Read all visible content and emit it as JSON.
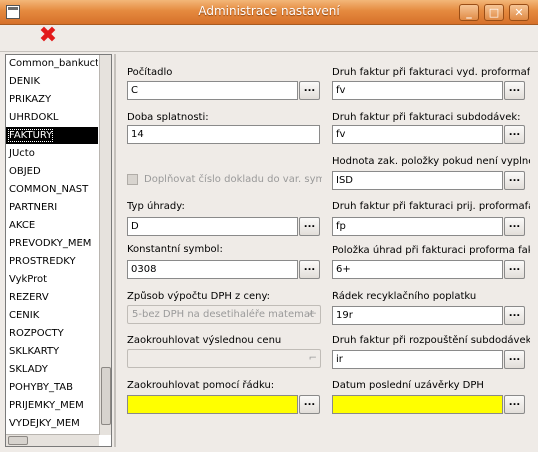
{
  "window": {
    "title": "Administrace nastavení",
    "minimize": "_",
    "maximize": "□",
    "close": "✕"
  },
  "toolbar": {
    "delete_icon": "close-icon-red",
    "delete_glyph": "✖"
  },
  "list": {
    "items": [
      "Common_bankucty",
      "DENIK",
      "PRIKAZY",
      "UHRDOKL",
      "FAKTURY",
      "JUcto",
      "OBJED",
      "COMMON_NAST",
      "PARTNERI",
      "AKCE",
      "PREVODKY_MEM",
      "PROSTREDKY",
      "VykProt",
      "REZERV",
      "CENIK",
      "ROZPOCTY",
      "SKLKARTY",
      "SKLADY",
      "POHYBY_TAB",
      "PRIJEMKY_MEM",
      "VYDEJKY_MEM"
    ],
    "selected": "FAKTURY"
  },
  "left": {
    "pocitadlo": {
      "label": "Počítadlo",
      "value": "C"
    },
    "doba": {
      "label": "Doba splatnosti:",
      "value": "14"
    },
    "doplnovat": {
      "label": "Doplňovat číslo dokladu do var. symb"
    },
    "typ": {
      "label": "Typ úhrady:",
      "value": "D"
    },
    "konst": {
      "label": "Konstantní symbol:",
      "value": "0308"
    },
    "zpusob": {
      "label": "Způsob výpočtu DPH z ceny:",
      "value": "5-bez DPH na desetihaléře matemat"
    },
    "zaokr_cenu": {
      "label": "Zaokrouhlovat výslednou cenu"
    },
    "zaokr_radek": {
      "label": "Zaokrouhlovat pomocí řádku:",
      "value": ""
    }
  },
  "right": {
    "druh_vyd": {
      "label": "Druh faktur při fakturaci vyd. proformafa",
      "value": "fv"
    },
    "druh_sub": {
      "label": "Druh faktur při fakturaci subdodávek:",
      "value": "fv"
    },
    "hodnota": {
      "label": "Hodnota zak. položky pokud není vyplněn",
      "value": "ISD"
    },
    "druh_prij": {
      "label": "Druh faktur při fakturaci prij. proformafak",
      "value": "fp"
    },
    "polozka": {
      "label": "Položka úhrad při fakturaci proforma fakt",
      "value": "6+"
    },
    "radek": {
      "label": "Řádek recyklačního poplatku",
      "value": "19r"
    },
    "druh_rozp": {
      "label": "Druh faktur při rozpouštění subdodávek:",
      "value": "ir"
    },
    "datum": {
      "label": "Datum poslední uzávěrky DPH",
      "value": ""
    }
  },
  "dots_label": "...",
  "colors": {
    "title_orange": "#e58a3f",
    "highlight_yellow": "#ffff00",
    "selected_bg": "#000000"
  }
}
